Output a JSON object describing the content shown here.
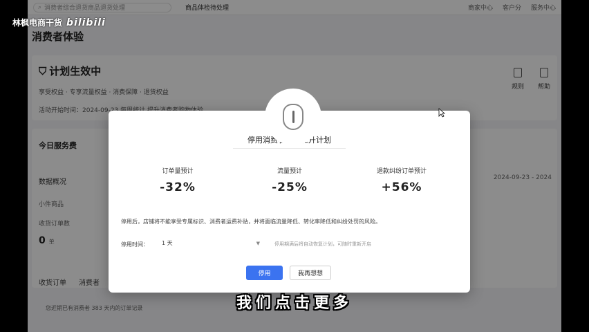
{
  "app": {
    "search_placeholder": "消费者综合退货商品退货处理",
    "tab_text": "商品体检待处理",
    "top_right": [
      "商家中心",
      "客户分",
      "服务中心"
    ],
    "page_title": "消费者体验",
    "plan_status": "计划生效中",
    "plan_desc": "享受权益 · 专享流量权益 · 消费保障 · 退货权益",
    "plan_info": "活动开始时间：2024-09-23 每周统计 提升消费者购物体验",
    "tools": [
      "规则",
      "帮助"
    ],
    "service_title": "今日服务费",
    "data_overview": "数据概况",
    "data_date": "2024-09-23 - 2024",
    "small_label": "小件商品",
    "refund_label": "收货订单数",
    "refund_value": "0",
    "refund_unit": "单",
    "tabs": [
      "收货订单",
      "消费者"
    ],
    "footer_note": "您近期已有消费者 383 天内的订单记录"
  },
  "modal": {
    "title": "停用消费者体验提升计划",
    "metrics": [
      {
        "label": "订单量预计",
        "value": "-32%"
      },
      {
        "label": "流量预计",
        "value": "-25%"
      },
      {
        "label": "退款纠纷订单预计",
        "value": "+56%"
      }
    ],
    "notice": "停用后，店铺将不能享受专属标识、消费者运费补贴，并将面临流量降低、转化率降低和纠纷处罚的风险。",
    "duration_label": "停用时间：",
    "duration_value": "1 天",
    "duration_note": "停用期满后将自动恢复计划，可随时重新开启",
    "stop_button": "停用",
    "later_button": "我再想想"
  },
  "overlay": {
    "watermark_text": "林枫电商干货",
    "watermark_logo": "bilibili",
    "subtitle": "我们点击更多"
  }
}
